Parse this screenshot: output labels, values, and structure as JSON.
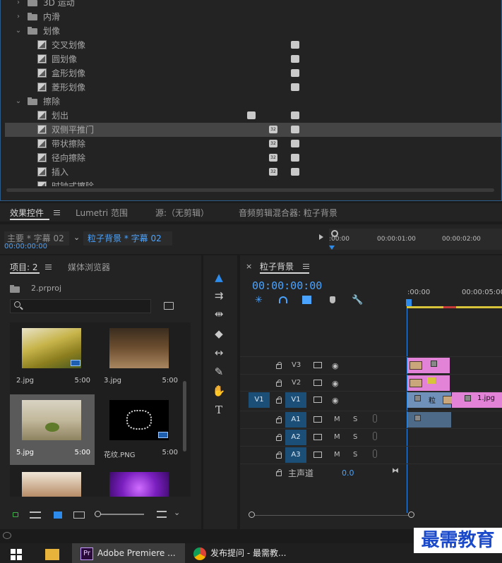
{
  "effects_tree": {
    "rows": [
      {
        "label": "3D 运动",
        "kind": "folder",
        "expanded": false
      },
      {
        "label": "内滑",
        "kind": "folder",
        "expanded": false
      },
      {
        "label": "划像",
        "kind": "folder",
        "expanded": true
      },
      {
        "label": "交叉划像",
        "kind": "effect"
      },
      {
        "label": "圆划像",
        "kind": "effect"
      },
      {
        "label": "盒形划像",
        "kind": "effect"
      },
      {
        "label": "菱形划像",
        "kind": "effect"
      },
      {
        "label": "擦除",
        "kind": "folder",
        "expanded": true
      },
      {
        "label": "划出",
        "kind": "effect"
      },
      {
        "label": "双侧平推门",
        "kind": "effect",
        "selected": true
      },
      {
        "label": "带状擦除",
        "kind": "effect"
      },
      {
        "label": "径向擦除",
        "kind": "effect"
      },
      {
        "label": "插入",
        "kind": "effect"
      },
      {
        "label": "时钟式擦除",
        "kind": "effect"
      }
    ],
    "badge_32": "32",
    "badge_yuv": "YUV"
  },
  "panel_tabs": {
    "effect_controls": "效果控件",
    "lumetri": "Lumetri 范围",
    "source": "源:（无剪辑）",
    "audio_mixer": "音频剪辑混合器: 粒子背景"
  },
  "effect_controls": {
    "master": "主要 * 字幕 02",
    "sequence_clip": "粒子背景 * 字幕 02",
    "timecode": "00:00:00:00",
    "ruler_times": [
      ":00:00",
      "00:00:01:00",
      "00:00:02:00"
    ]
  },
  "project": {
    "tab_label": "项目: 2",
    "media_browser": "媒体浏览器",
    "file_name": "2.prproj",
    "search_placeholder": "",
    "items": [
      {
        "name": "2.jpg",
        "duration": "5:00"
      },
      {
        "name": "3.jpg",
        "duration": "5:00"
      },
      {
        "name": "5.jpg",
        "duration": "5:00"
      },
      {
        "name": "花纹.PNG",
        "duration": "5:00"
      },
      {
        "name": "",
        "duration": ""
      },
      {
        "name": "",
        "duration": ""
      }
    ]
  },
  "timeline": {
    "sequence_name": "粒子背景",
    "timecode": "00:00:00:00",
    "ruler_labels": [
      ":00:00",
      "00:00:05:00"
    ],
    "tracks": [
      {
        "name": "V3"
      },
      {
        "name": "V2"
      },
      {
        "name": "V1",
        "source": "V1"
      },
      {
        "name": "A1",
        "mute": "M",
        "solo": "S"
      },
      {
        "name": "A2",
        "mute": "M",
        "solo": "S"
      },
      {
        "name": "A3",
        "mute": "M",
        "solo": "S"
      }
    ],
    "master_label": "主声道",
    "master_value": "0.0",
    "clips": {
      "v1_clip_label": "粒",
      "v1_clip2_label": "1.jpg"
    }
  },
  "taskbar": {
    "premiere_label": "Adobe Premiere ...",
    "chrome_label": "发布提问 - 最需教...",
    "watermark": "最需教育"
  },
  "colors": {
    "accent_blue": "#2d8ceb",
    "timecode_blue": "#4aa3ff",
    "clip_pink": "#e383d8",
    "clip_blue": "#6f90b8",
    "track_target": "#1c4f77"
  }
}
